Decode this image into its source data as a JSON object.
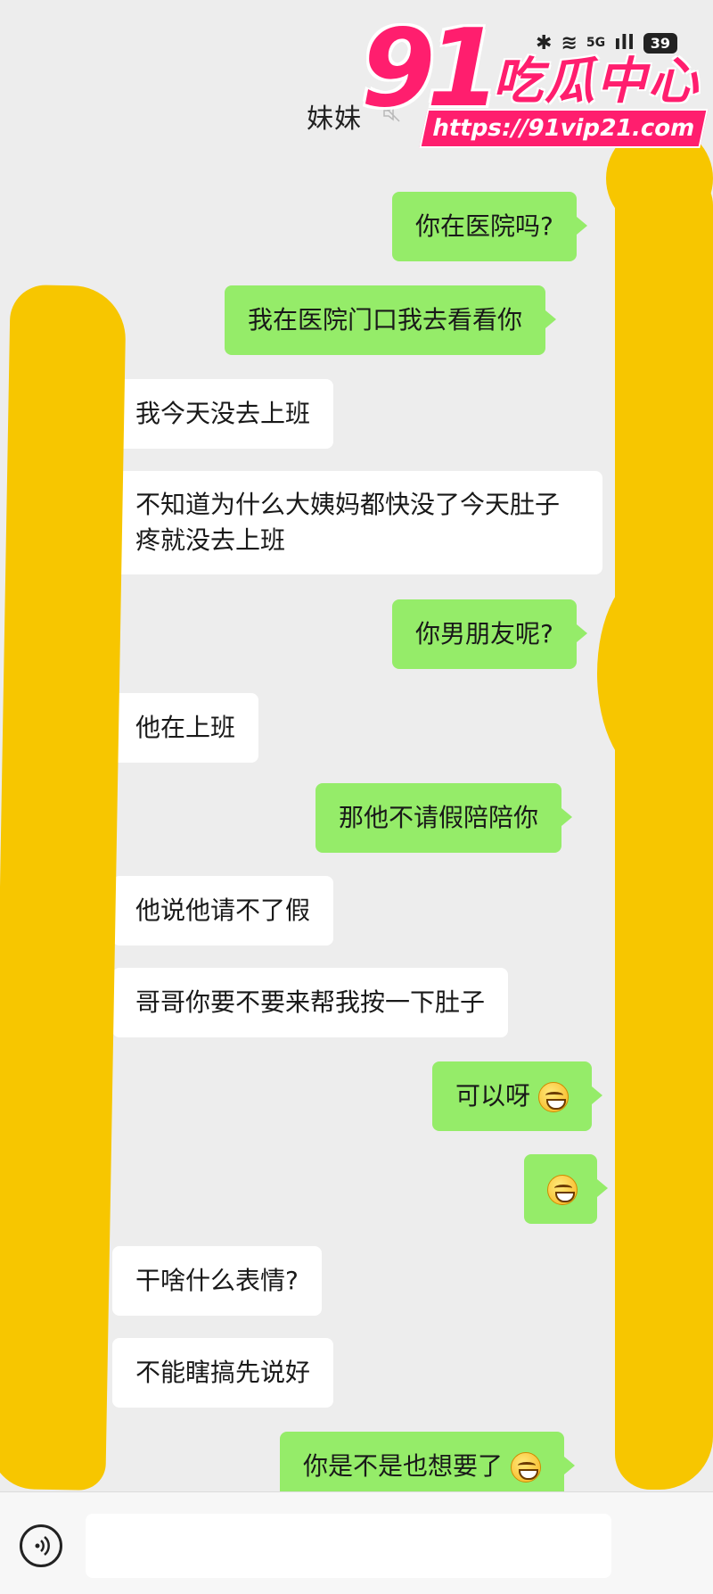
{
  "header": {
    "contact_name": "妹妹",
    "header_icon": "mute-icon"
  },
  "status_bar": {
    "bluetooth": "✱",
    "wifi": "≋",
    "network": "5G",
    "signal": "ıll",
    "battery": "39"
  },
  "watermark": {
    "number": "91",
    "title": "吃瓜中心",
    "url": "https://91vip21.com"
  },
  "messages": [
    {
      "side": "out",
      "text": "你在医院吗?"
    },
    {
      "side": "out",
      "text": "我在医院门口我去看看你"
    },
    {
      "side": "in",
      "text": "我今天没去上班"
    },
    {
      "side": "in",
      "text": "不知道为什么大姨妈都快没了今天肚子疼就没去上班"
    },
    {
      "side": "out",
      "text": "你男朋友呢?"
    },
    {
      "side": "in",
      "text": "他在上班"
    },
    {
      "side": "out",
      "text": "那他不请假陪陪你"
    },
    {
      "side": "in",
      "text": "他说他请不了假"
    },
    {
      "side": "in",
      "text": "哥哥你要不要来帮我按一下肚子"
    },
    {
      "side": "out",
      "text": "可以呀",
      "emoji": "smirk-emoji"
    },
    {
      "side": "out",
      "text": "",
      "emoji": "grin-emoji"
    },
    {
      "side": "in",
      "text": "干啥什么表情?"
    },
    {
      "side": "in",
      "text": "不能瞎搞先说好"
    },
    {
      "side": "out",
      "text": "你是不是也想要了",
      "emoji": "drool-emoji"
    }
  ],
  "input_bar": {
    "voice_icon": "voice-icon",
    "input_value": ""
  },
  "colors": {
    "background": "#ededed",
    "outgoing_bubble": "#95ec69",
    "incoming_bubble": "#ffffff",
    "watermark": "#ff1e6e",
    "censor": "#f7c600"
  }
}
